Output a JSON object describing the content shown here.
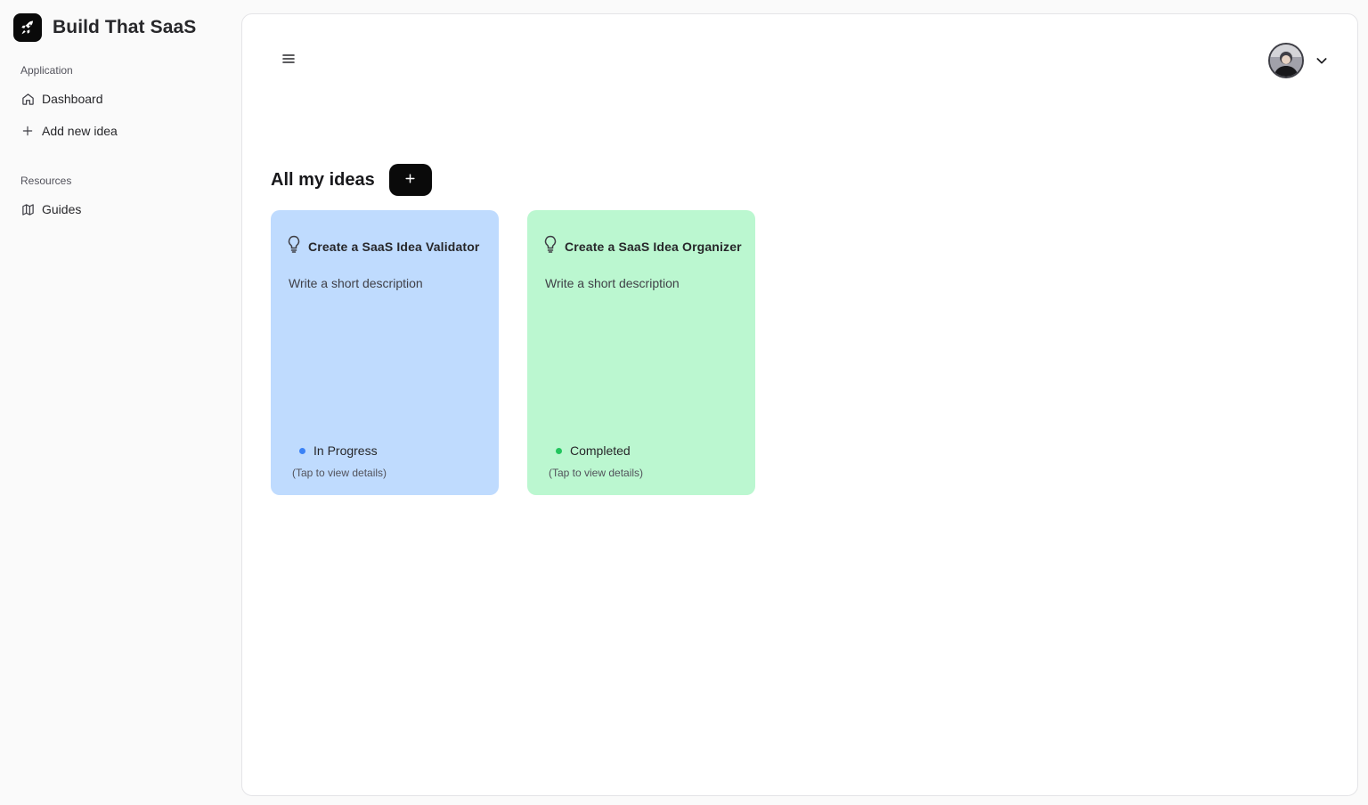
{
  "sidebar": {
    "brand": {
      "name": "Build That SaaS",
      "icon": "rocket-icon"
    },
    "groups": [
      {
        "label": "Application",
        "items": [
          {
            "label": "Dashboard",
            "icon": "home-icon"
          },
          {
            "label": "Add new idea",
            "icon": "plus-icon"
          }
        ]
      },
      {
        "label": "Resources",
        "items": [
          {
            "label": "Guides",
            "icon": "map-icon"
          }
        ]
      }
    ]
  },
  "header": {
    "menu_icon": "hamburger-menu-icon",
    "user_menu_icon": "chevron-down-icon"
  },
  "main": {
    "title": "All my ideas",
    "add_icon": "plus-icon",
    "ideas": [
      {
        "title": "Create a SaaS Idea Validator",
        "description": "Write a short description",
        "status": "In Progress",
        "status_color": "#3b82f6",
        "card_color": "#bfdbfe",
        "hint": "(Tap to view details)",
        "icon": "lightbulb-icon"
      },
      {
        "title": "Create a SaaS Idea Organizer",
        "description": "Write a short description",
        "status": "Completed",
        "status_color": "#22c55e",
        "card_color": "#bbf7d0",
        "hint": "(Tap to view details)",
        "icon": "lightbulb-icon"
      }
    ]
  }
}
